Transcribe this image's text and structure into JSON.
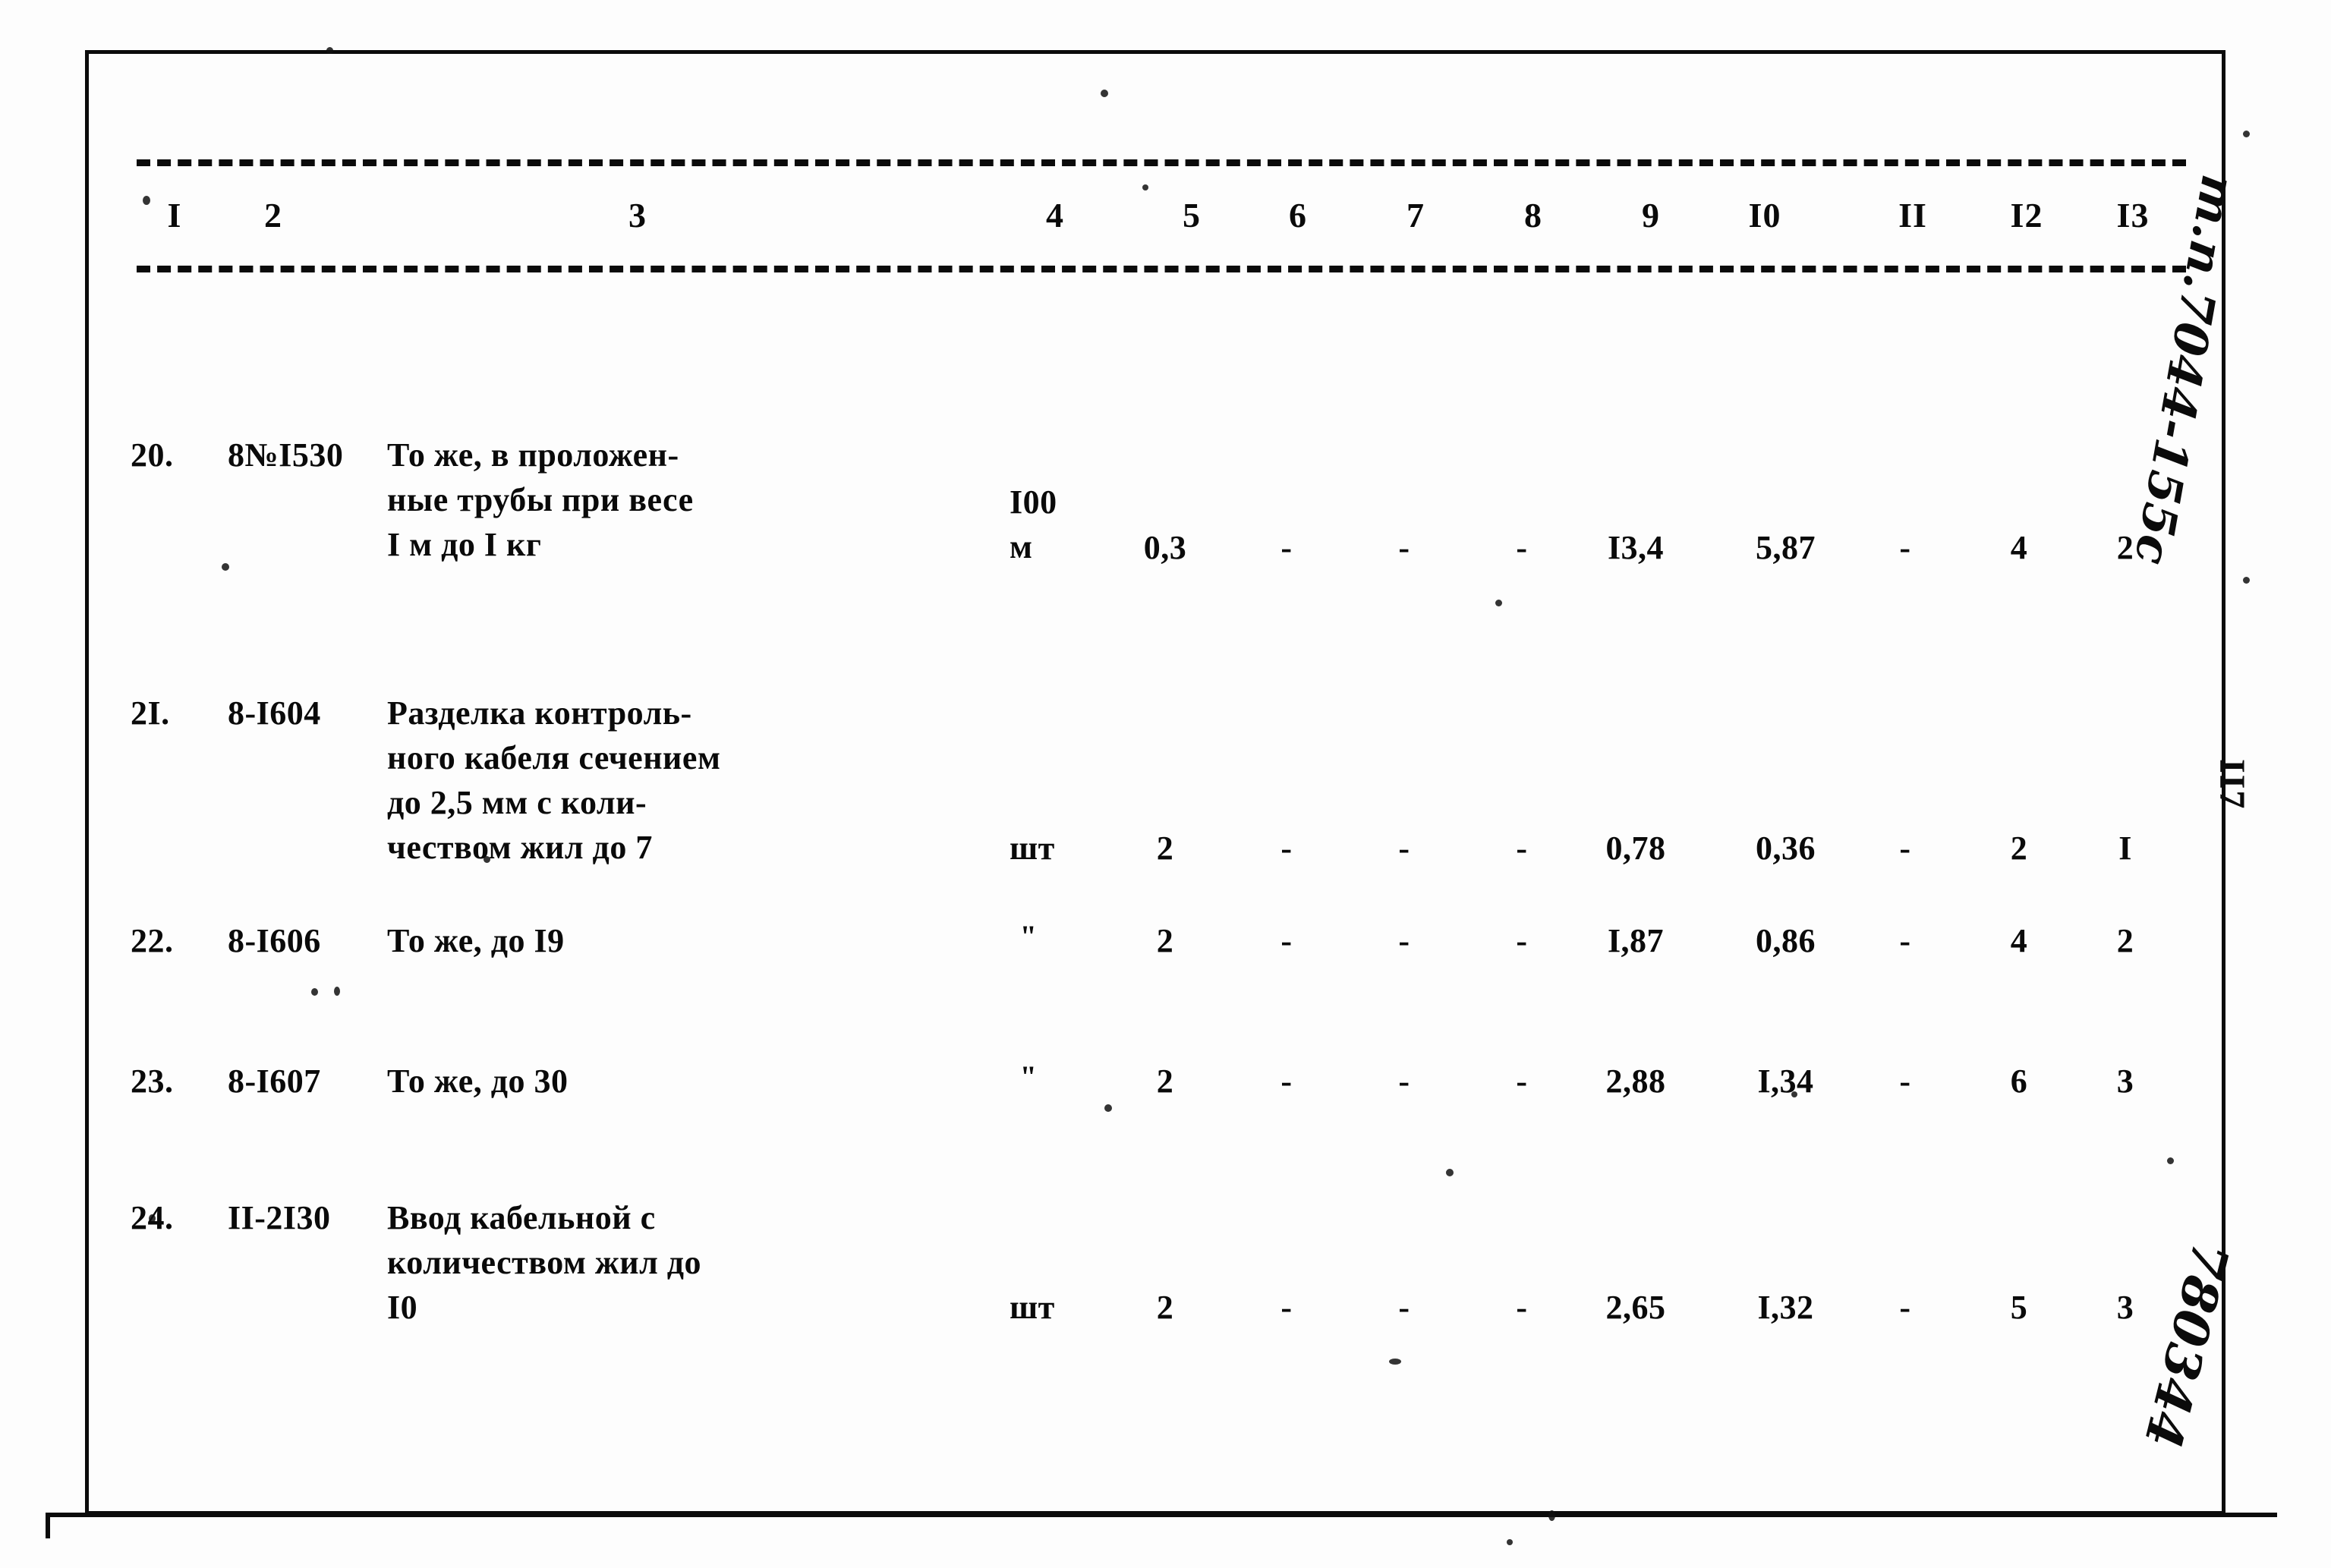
{
  "document": {
    "page_number": "II7",
    "margin_note_top": "т.п.7044-155с",
    "margin_note_bottom": "780344"
  },
  "table": {
    "column_headers": [
      "I",
      "2",
      "3",
      "4",
      "5",
      "6",
      "7",
      "8",
      "9",
      "I0",
      "II",
      "I2",
      "I3"
    ],
    "rows": [
      {
        "no": "20.",
        "code": "8№I530",
        "description": "То же, в проложен-\nные трубы при весе\nI м до I кг",
        "unit": "I00\nм",
        "c5": "0,3",
        "c6": "-",
        "c7": "-",
        "c8": "-",
        "c9": "I3,4",
        "c10": "5,87",
        "c11": "-",
        "c12": "4",
        "c13": "2"
      },
      {
        "no": "2I.",
        "code": "8-I604",
        "description": "Разделка контроль-\nного кабеля сечением\nдо 2,5 мм с коли-\nчеством жил до 7",
        "unit": "шт",
        "c5": "2",
        "c6": "-",
        "c7": "-",
        "c8": "-",
        "c9": "0,78",
        "c10": "0,36",
        "c11": "-",
        "c12": "2",
        "c13": "I"
      },
      {
        "no": "22.",
        "code": "8-I606",
        "description": "То же, до I9",
        "unit": "\"",
        "c5": "2",
        "c6": "-",
        "c7": "-",
        "c8": "-",
        "c9": "I,87",
        "c10": "0,86",
        "c11": "-",
        "c12": "4",
        "c13": "2"
      },
      {
        "no": "23.",
        "code": "8-I607",
        "description": "То же, до 30",
        "unit": "\"",
        "c5": "2",
        "c6": "-",
        "c7": "-",
        "c8": "-",
        "c9": "2,88",
        "c10": "I,34",
        "c11": "-",
        "c12": "6",
        "c13": "3"
      },
      {
        "no": "24.",
        "code": "II-2I30",
        "description": "Ввод кабельной с\nколичеством жил до\n             I0",
        "unit": "шт",
        "c5": "2",
        "c6": "-",
        "c7": "-",
        "c8": "-",
        "c9": "2,65",
        "c10": "I,32",
        "c11": "-",
        "c12": "5",
        "c13": "3"
      }
    ]
  }
}
